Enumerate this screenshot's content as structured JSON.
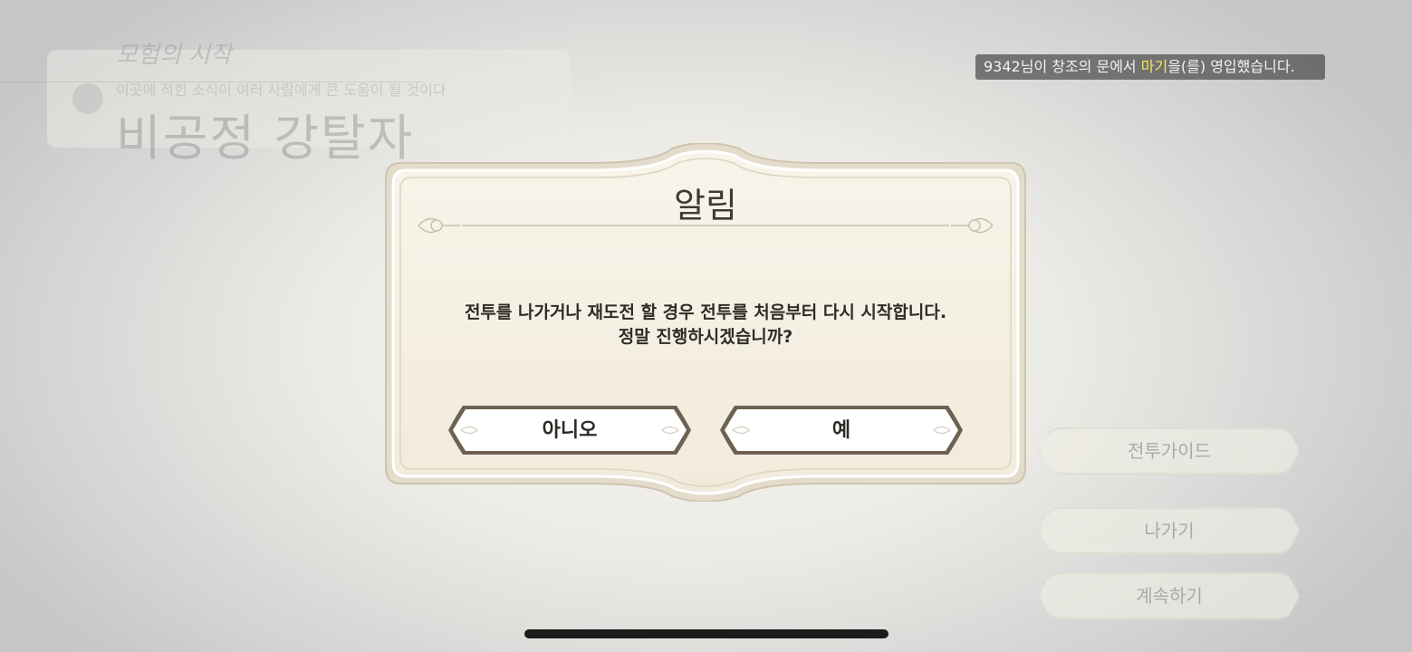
{
  "background_quest": {
    "chapter": "모험의 시작",
    "subtitle": "이곳에 적힌 소식이 여러 사람에게 큰 도움이 될 것이다",
    "title": "비공정 강탈자"
  },
  "notification": {
    "prefix": "9342님이 창조의 문에서 ",
    "highlight": "마기",
    "suffix": "을(를) 영입했습니다.",
    "highlight_color": "#f3e55c"
  },
  "side_menu": {
    "guide_label": "전투가이드",
    "exit_label": "나가기",
    "continue_label": "계속하기"
  },
  "dialog": {
    "title": "알림",
    "message_line1": "전투를 나가거나 재도전 할 경우 전투를 처음부터 다시 시작합니다.",
    "message_line2": "정말 진행하시겠습니까?",
    "no_label": "아니오",
    "yes_label": "예"
  },
  "colors": {
    "dialog_bg": "#f4efe3",
    "dialog_border": "#d9cfbb",
    "button_fill": "#ffffff",
    "button_border": "#6b5f50"
  }
}
